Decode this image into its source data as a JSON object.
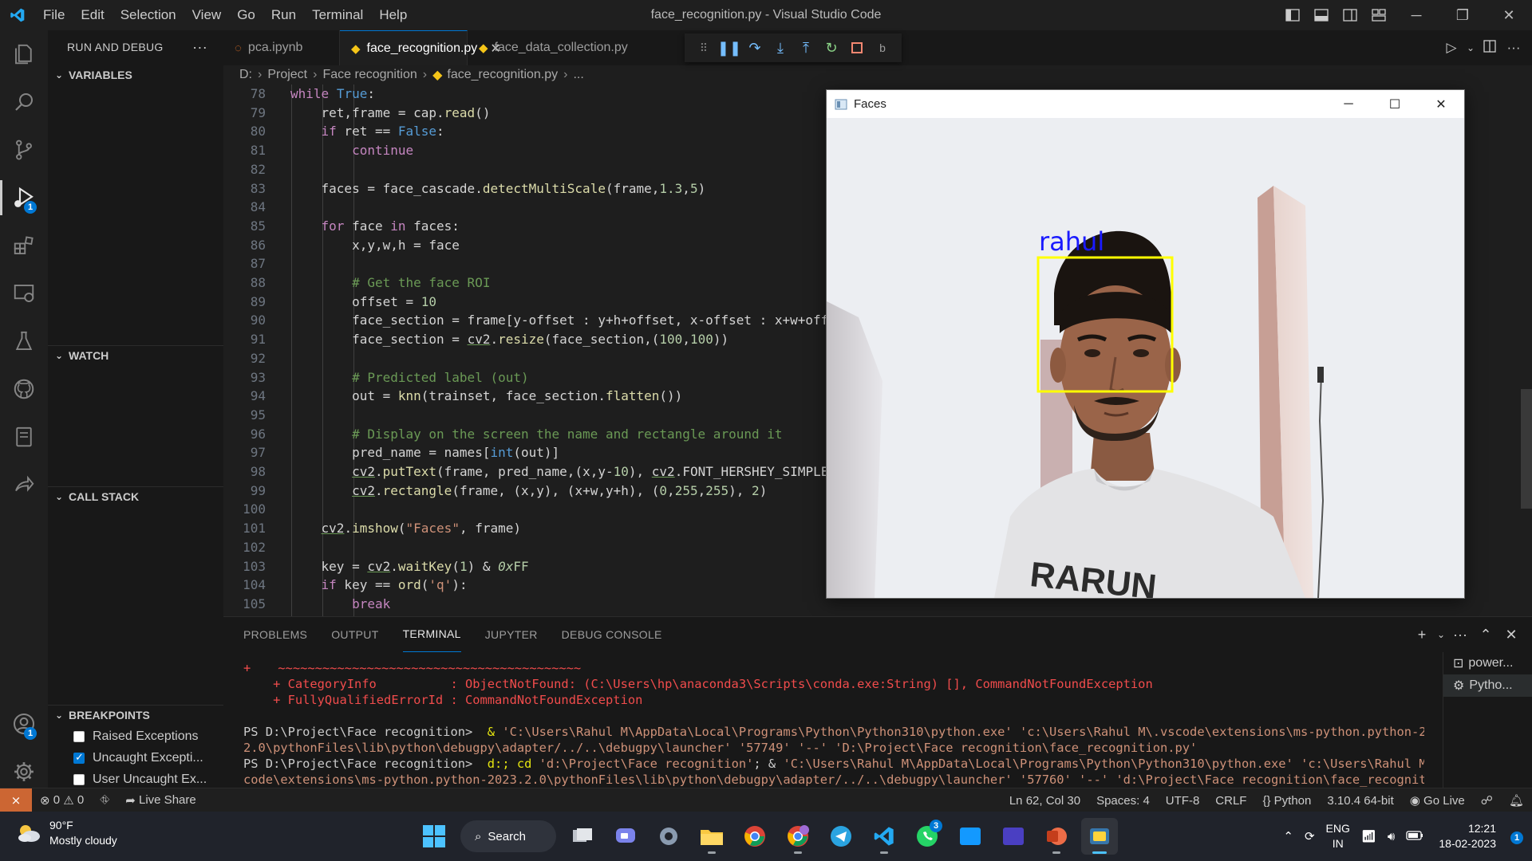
{
  "window": {
    "title": "face_recognition.py - Visual Studio Code",
    "menu": [
      "File",
      "Edit",
      "Selection",
      "View",
      "Go",
      "Run",
      "Terminal",
      "Help"
    ]
  },
  "activity_bar": {
    "debug_badge": "1",
    "accounts_badge": "1"
  },
  "sidebar": {
    "header": "RUN AND DEBUG",
    "sections": {
      "variables": "VARIABLES",
      "watch": "WATCH",
      "call_stack": "CALL STACK",
      "breakpoints": "BREAKPOINTS"
    },
    "breakpoints": [
      {
        "label": "Raised Exceptions",
        "checked": false
      },
      {
        "label": "Uncaught Excepti...",
        "checked": true
      },
      {
        "label": "User Uncaught Ex...",
        "checked": false
      }
    ]
  },
  "tabs": [
    {
      "label": "pca.ipynb",
      "icon": "notebook-icon",
      "active": false
    },
    {
      "label": "face_recognition.py",
      "icon": "python-icon",
      "active": true
    },
    {
      "label": "face_data_collection.py",
      "icon": "python-icon",
      "active": false
    }
  ],
  "debug_toolbar_overflow": "b",
  "breadcrumb": [
    "D:",
    "Project",
    "Face recognition",
    "face_recognition.py",
    "..."
  ],
  "code_lines": [
    78,
    79,
    80,
    81,
    82,
    83,
    84,
    85,
    86,
    87,
    88,
    89,
    90,
    91,
    92,
    93,
    94,
    95,
    96,
    97,
    98,
    99,
    100,
    101,
    102,
    103,
    104,
    105
  ],
  "faces_window": {
    "title": "Faces",
    "detected_name": "rahul",
    "box_color": "#ffff00",
    "label_color": "#1a1aff"
  },
  "panel": {
    "tabs": [
      "PROBLEMS",
      "OUTPUT",
      "TERMINAL",
      "JUPYTER",
      "DEBUG CONSOLE"
    ],
    "active_tab": "TERMINAL",
    "terminal_instances": [
      "power...",
      "Pytho..."
    ],
    "terminal": {
      "line1_plus": "+",
      "line1_tilde": "~~~~~~~~~~~~~~~~~~~~~~~~~~~~~~~~~~~~~~~~~",
      "line2": "    + CategoryInfo          : ObjectNotFound: (C:\\Users\\hp\\anaconda3\\Scripts\\conda.exe:String) [], CommandNotFoundException",
      "line3": "    + FullyQualifiedErrorId : CommandNotFoundException",
      "prompt1": "PS D:\\Project\\Face recognition> ",
      "cmd1_amp": " & ",
      "cmd1_args": "'C:\\Users\\Rahul M\\AppData\\Local\\Programs\\Python\\Python310\\python.exe' 'c:\\Users\\Rahul M\\.vscode\\extensions\\ms-python.python-2023.",
      "cmd1_cont": "2.0\\pythonFiles\\lib\\python\\debugpy\\adapter/../..\\debugpy\\launcher' '57749' '--' 'D:\\Project\\Face recognition\\face_recognition.py'",
      "prompt2": "PS D:\\Project\\Face recognition> ",
      "cmd2_head": " d:; cd ",
      "cmd2_path": "'d:\\Project\\Face recognition'",
      "cmd2_amp": "; & ",
      "cmd2_args": "'C:\\Users\\Rahul M\\AppData\\Local\\Programs\\Python\\Python310\\python.exe' 'c:\\Users\\Rahul M\\.vs",
      "cmd2_cont": "code\\extensions\\ms-python.python-2023.2.0\\pythonFiles\\lib\\python\\debugpy\\adapter/../..\\debugpy\\launcher' '57760' '--' 'd:\\Project\\Face recognition\\face_recognition."
    }
  },
  "statusbar": {
    "errors": "0",
    "warnings": "0",
    "live_share": "Live Share",
    "position": "Ln 62, Col 30",
    "spaces": "Spaces: 4",
    "encoding": "UTF-8",
    "eol": "CRLF",
    "language": "Python",
    "interpreter": "3.10.4 64-bit",
    "go_live": "Go Live"
  },
  "taskbar": {
    "temperature": "90°F",
    "weather": "Mostly cloudy",
    "search": "Search",
    "whatsapp_badge": "3",
    "language_top": "ENG",
    "language_bottom": "IN",
    "time": "12:21",
    "date": "18-02-2023",
    "notification_badge": "1"
  }
}
